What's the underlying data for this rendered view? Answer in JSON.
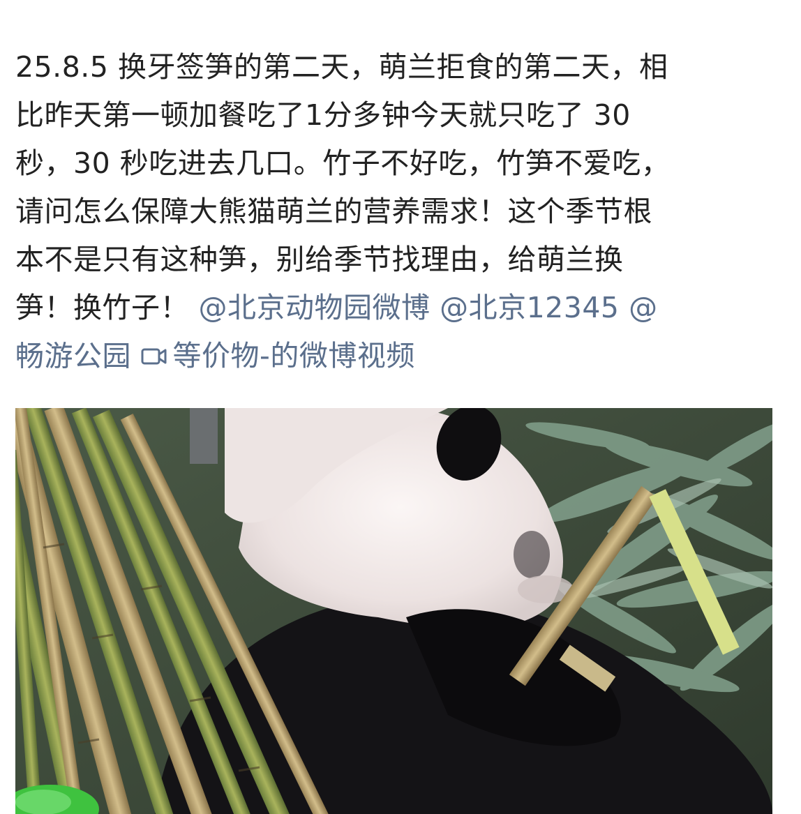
{
  "post": {
    "lines": [
      "25.8.5 换牙签笋的第二天，萌兰拒食的第二天，相",
      "比昨天第一顿加餐吃了1分多钟今天就只吃了 30",
      "秒，30 秒吃进去几口。竹子不好吃，竹笋不爱吃，",
      "请问怎么保障大熊猫萌兰的营养需求！这个季节根",
      "本不是只有这种笋，别给季节找理由，给萌兰换"
    ],
    "last_line_prefix": "笋！换竹子！",
    "mentions": [
      "@北京动物园微博",
      "@北京12345",
      "@"
    ],
    "mention_cont": "畅游公园",
    "video_link_label": "等价物-的微博视频",
    "video_icon": "video-camera-icon",
    "link_color": "#5b6f8c",
    "text_color": "#222222"
  },
  "media": {
    "image_icon": "panda-eating-bamboo-photo"
  }
}
